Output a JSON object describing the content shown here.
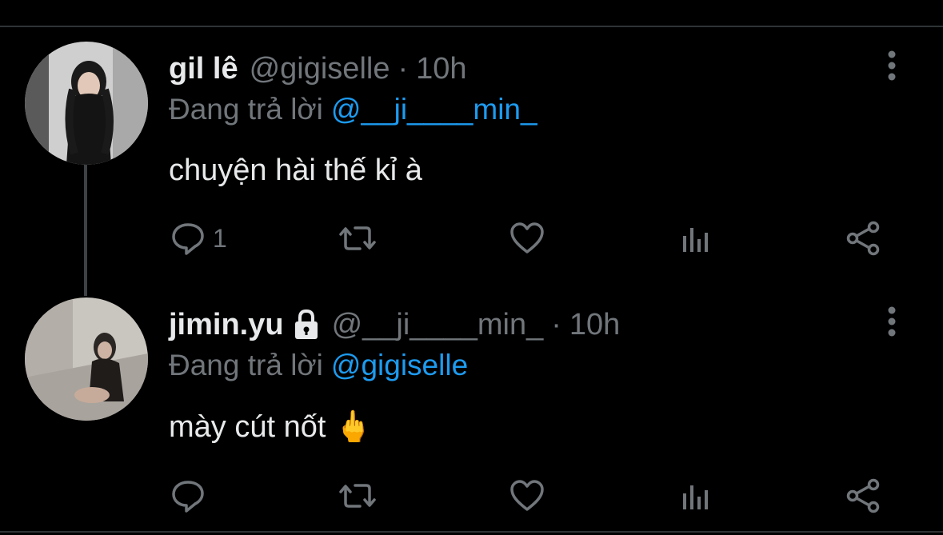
{
  "tweets": [
    {
      "display_name": "gil lê",
      "handle": "@gigiselle",
      "dot": "·",
      "time": "10h",
      "reply_prefix": "Đang trả lời",
      "reply_to": "@__ji____min_",
      "text": "chuyện hài thế kỉ à",
      "reply_count": "1",
      "locked": false
    },
    {
      "display_name": "jimin.yu",
      "handle": "@__ji____min_",
      "dot": "·",
      "time": "10h",
      "reply_prefix": "Đang trả lời",
      "reply_to": "@gigiselle",
      "text": "mày cút nốt 🖕",
      "reply_count": "",
      "locked": true
    }
  ],
  "icons": {
    "reply": "reply-icon",
    "retweet": "retweet-icon",
    "like": "heart-icon",
    "views": "analytics-icon",
    "share": "share-icon",
    "more": "more-vertical-icon",
    "lock": "lock-icon"
  },
  "colors": {
    "background": "#000000",
    "text_primary": "#e7e9ea",
    "text_secondary": "#71767b",
    "mention": "#1d9bf0",
    "divider": "#2f3336"
  }
}
